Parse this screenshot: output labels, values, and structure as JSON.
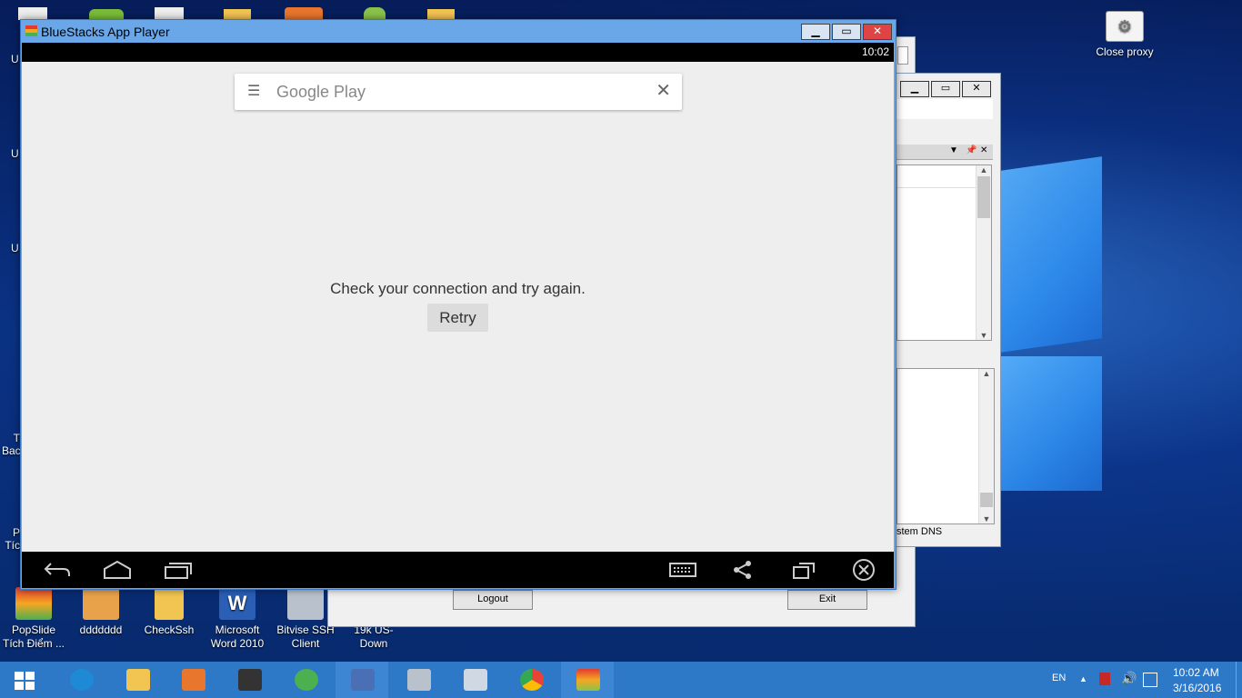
{
  "desktop": {
    "icons": [
      {
        "label": "PopSlide\nTích Điểm ...",
        "color": "#e23b2f"
      },
      {
        "label": "ddddddd",
        "color": "#e8a34a"
      },
      {
        "label": "CheckSsh",
        "color": "#f2c552"
      },
      {
        "label": "Microsoft\nWord 2010",
        "color": "#2b5fb6"
      },
      {
        "label": "Bitvise SSH\nClient",
        "color": "#b9c2cc"
      },
      {
        "label": "19k US-Down",
        "color": "#f2c552"
      }
    ],
    "close_proxy_label": "Close proxy",
    "partial_labels": [
      "U",
      "U",
      "U",
      "T\nBac",
      "P\nTíc"
    ]
  },
  "back_window": {
    "logout_label": "Logout",
    "exit_label": "Exit",
    "dns_fragment": "stem DNS"
  },
  "bluestacks": {
    "title": "BlueStacks App Player",
    "time": "10:02",
    "search_title": "Google Play",
    "message": "Check your connection and try again.",
    "retry_label": "Retry"
  },
  "taskbar": {
    "language": "EN",
    "clock_time": "10:02 AM",
    "clock_date": "3/16/2016",
    "items": [
      {
        "name": "internet-explorer",
        "color": "#1e8ad6"
      },
      {
        "name": "file-explorer",
        "color": "#f2c552"
      },
      {
        "name": "media-player",
        "color": "#e8762c"
      },
      {
        "name": "server-app",
        "color": "#333333"
      },
      {
        "name": "network-app",
        "color": "#4caf50"
      },
      {
        "name": "proxy-app",
        "color": "#4a6fb5"
      },
      {
        "name": "bitvise-app",
        "color": "#b9c2cc"
      },
      {
        "name": "tools-app",
        "color": "#cfd8e3"
      },
      {
        "name": "chrome",
        "color": "#ea4335"
      },
      {
        "name": "bluestacks",
        "color": "#8bc34a"
      }
    ]
  }
}
